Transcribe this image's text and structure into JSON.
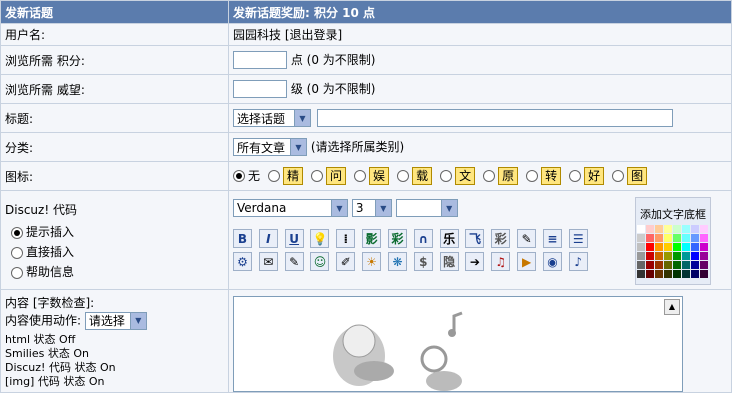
{
  "header": {
    "left": "发新话题",
    "right": "发新话题奖励: 积分 10 点"
  },
  "username": {
    "label": "用户名:",
    "value": "园园科技 [退出登录]"
  },
  "read_credit": {
    "label": "浏览所需 积分:",
    "unit": "点 (0 为不限制)"
  },
  "read_prestige": {
    "label": "浏览所需 威望:",
    "unit": "级 (0 为不限制)"
  },
  "title": {
    "label": "标题:",
    "select": "选择话题"
  },
  "category": {
    "label": "分类:",
    "select": "所有文章",
    "hint": "(请选择所属类别)"
  },
  "icon_row": {
    "label": "图标:",
    "none": "无",
    "badges": [
      "精",
      "问",
      "娱",
      "载",
      "文",
      "原",
      "转",
      "好",
      "图"
    ]
  },
  "discuz": {
    "label": "Discuz! 代码",
    "modes": [
      "提示插入",
      "直接插入",
      "帮助信息"
    ],
    "font": "Verdana",
    "size": "3",
    "bg_title": "添加文字底框",
    "row1": [
      "B",
      "I",
      "U",
      "💡",
      "⁞",
      "影",
      "彩",
      "∩",
      "乐",
      "飞",
      "彩",
      "✎",
      "≡",
      "☰"
    ],
    "row2": [
      "⚙",
      "✉",
      "✎",
      "☺",
      "✐",
      "☀",
      "❋",
      "$",
      "隐",
      "➔",
      "♫",
      "▶",
      "◉",
      "♪"
    ]
  },
  "content": {
    "label": "内容 [字数检查]:",
    "action_label": "内容使用动作:",
    "action_select": "请选择",
    "status": [
      "html 状态 Off",
      "Smilies 状态 On",
      "Discuz! 代码 状态 On",
      "[img] 代码 状态 On"
    ]
  },
  "colors": {
    "header_bg": "#5b7cad",
    "row_bg": "#f4f6fa",
    "border": "#c8d2e0"
  }
}
